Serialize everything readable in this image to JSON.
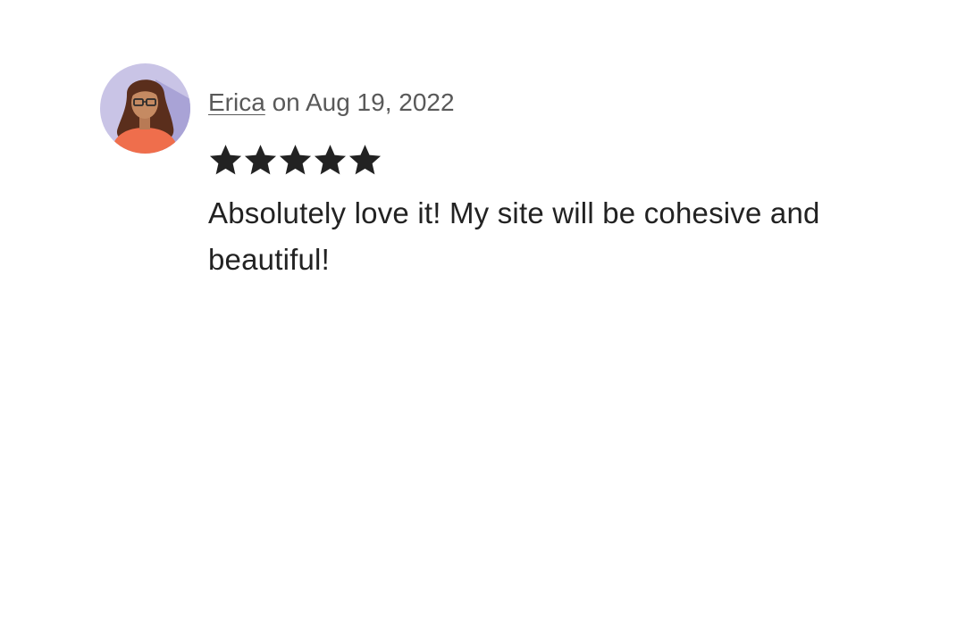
{
  "review": {
    "reviewer": "Erica",
    "date_text": "on Aug 19, 2022",
    "rating": 5,
    "rating_max": 5,
    "text": "Absolutely love it! My site will be cohesive and beautiful!",
    "avatar_icon": "woman-avatar-icon",
    "colors": {
      "avatar_background": "#c9c4e6",
      "star": "#222222",
      "meta_text": "#595959",
      "body_text": "#222222"
    }
  }
}
